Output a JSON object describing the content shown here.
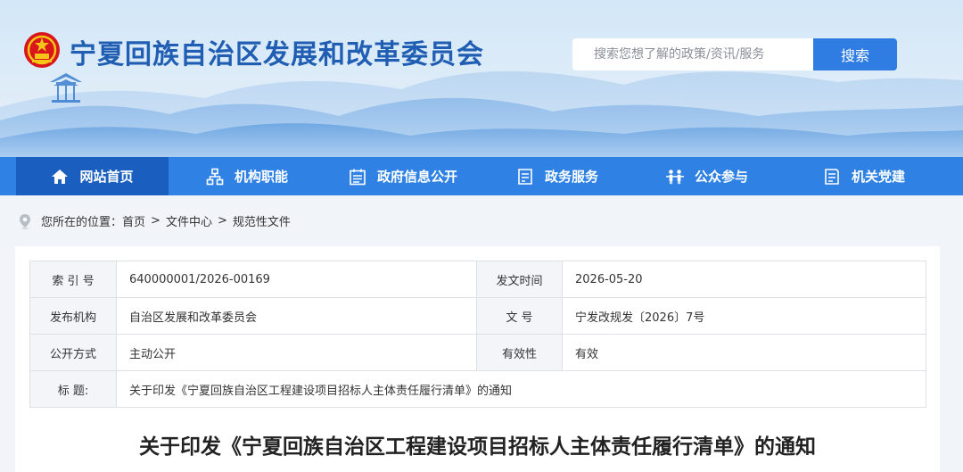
{
  "header": {
    "site_title": "宁夏回族自治区发展和改革委员会",
    "search_placeholder": "搜索您想了解的政策/资讯/服务",
    "search_button": "搜索"
  },
  "nav": {
    "items": [
      {
        "label": "网站首页",
        "icon": "home-icon",
        "active": true
      },
      {
        "label": "机构职能",
        "icon": "org-chart-icon",
        "active": false
      },
      {
        "label": "政府信息公开",
        "icon": "calendar-list-icon",
        "active": false
      },
      {
        "label": "政务服务",
        "icon": "service-doc-icon",
        "active": false
      },
      {
        "label": "公众参与",
        "icon": "people-icon",
        "active": false
      },
      {
        "label": "机关党建",
        "icon": "party-doc-icon",
        "active": false
      }
    ]
  },
  "breadcrumb": {
    "prefix": "您所在的位置：",
    "items": [
      "首页",
      "文件中心",
      "规范性文件"
    ],
    "separator": ">"
  },
  "info_table": {
    "rows": [
      [
        {
          "label": "索 引 号",
          "value": "640000001/2026-00169"
        },
        {
          "label": "发文时间",
          "value": "2026-05-20"
        }
      ],
      [
        {
          "label": "发布机构",
          "value": "自治区发展和改革委员会"
        },
        {
          "label": "文 号",
          "value": "宁发改规发〔2026〕7号"
        }
      ],
      [
        {
          "label": "公开方式",
          "value": "主动公开"
        },
        {
          "label": "有效性",
          "value": "有效"
        }
      ]
    ],
    "title_label": "标 题:",
    "title_value": "关于印发《宁夏回族自治区工程建设项目招标人主体责任履行清单》的通知"
  },
  "document": {
    "title": "关于印发《宁夏回族自治区工程建设项目招标人主体责任履行清单》的通知"
  },
  "colors": {
    "brand_blue": "#2f82e3",
    "nav_active": "#1a5fc0",
    "title_blue": "#1f5eb2",
    "emblem_red": "#d8161b"
  }
}
